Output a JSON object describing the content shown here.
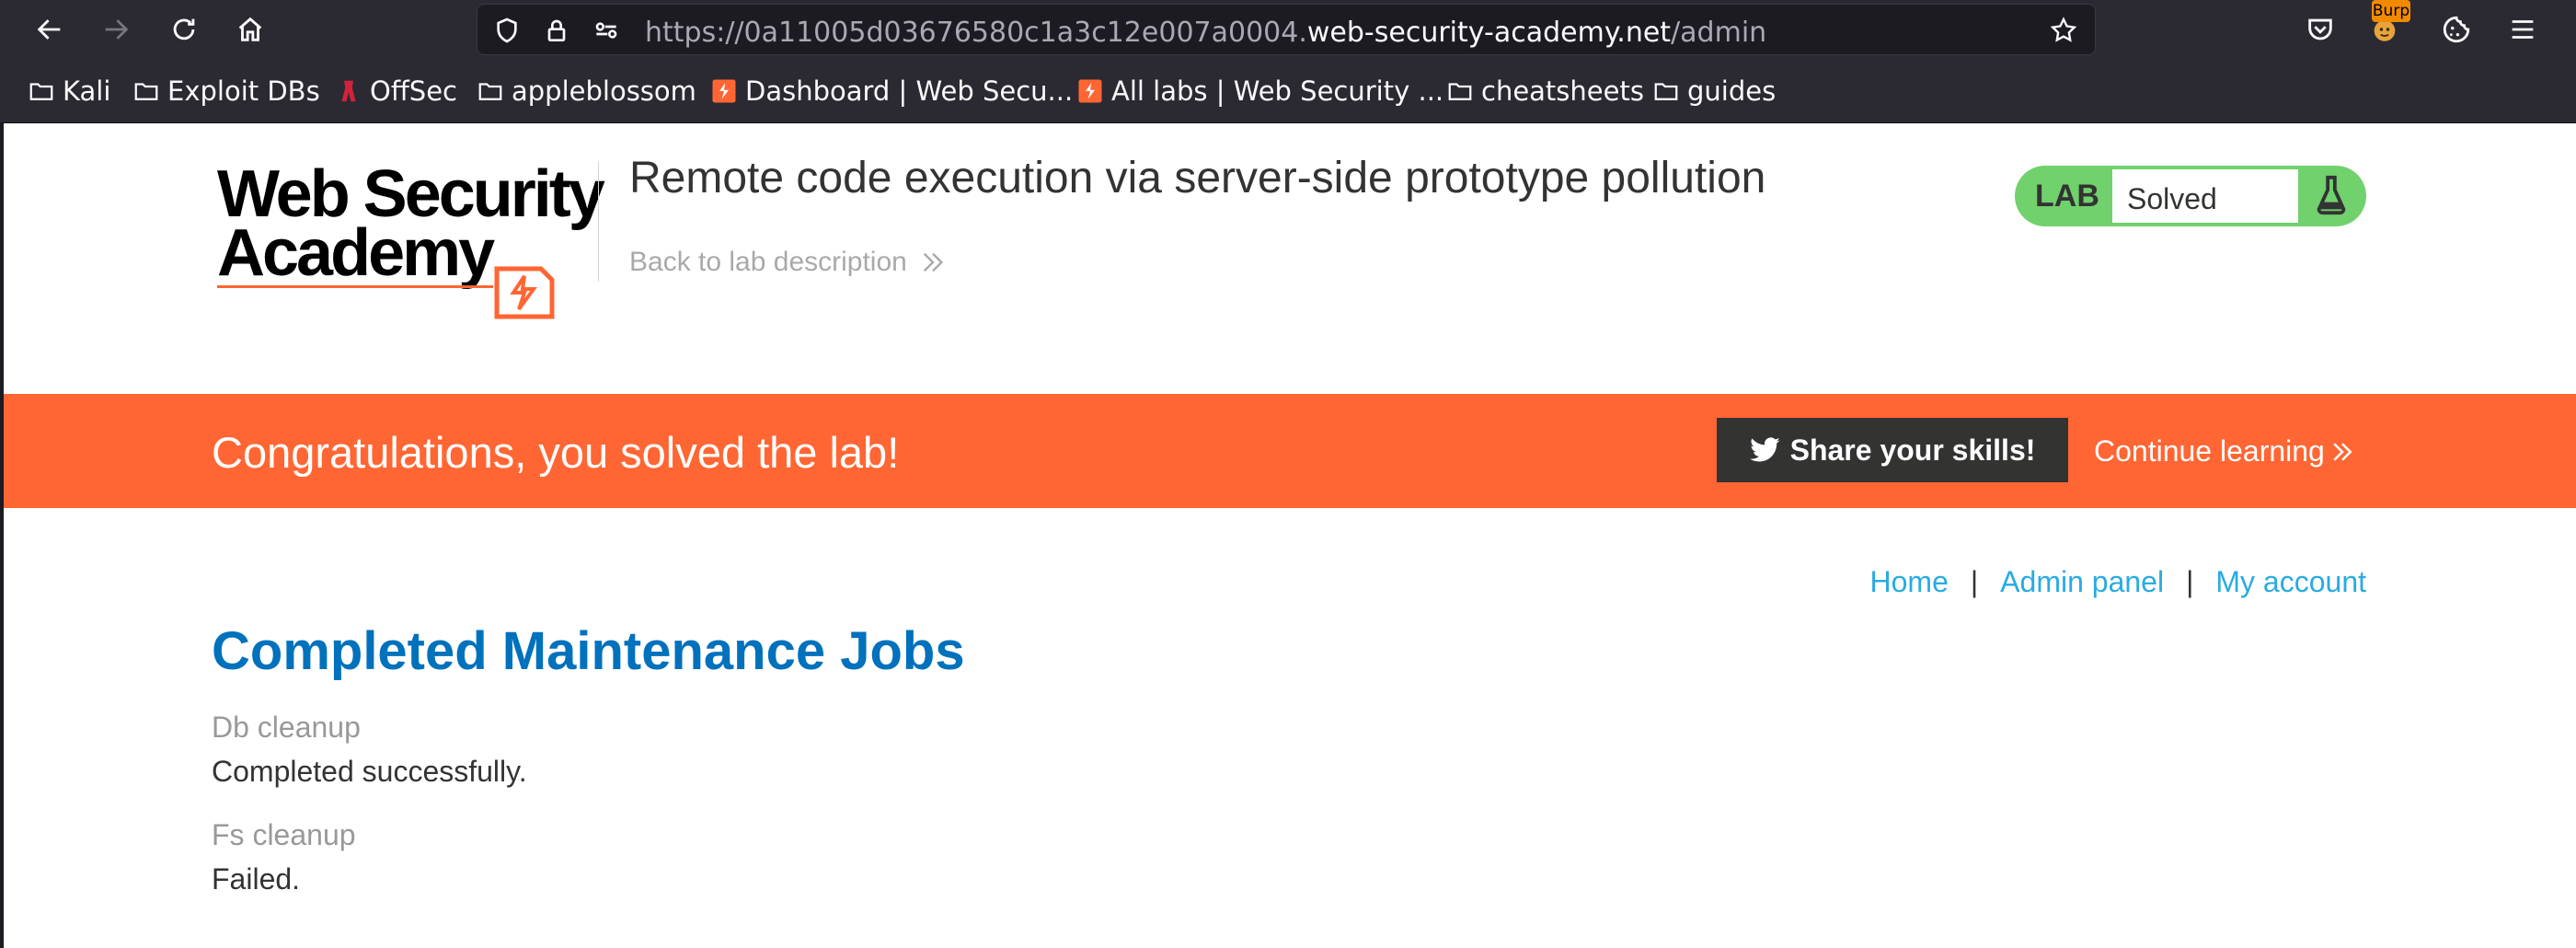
{
  "browser": {
    "url_prefix": "https://0a11005d03676580c1a3c12e007a0004.",
    "url_domain": "web-security-academy.net",
    "url_path": "/admin",
    "burp_badge": "Burp",
    "bookmarks": [
      {
        "label": "Kali",
        "icon": "folder-icon"
      },
      {
        "label": "Exploit DBs",
        "icon": "folder-icon"
      },
      {
        "label": "OffSec",
        "icon": "offsec-icon"
      },
      {
        "label": "appleblossom",
        "icon": "folder-icon"
      },
      {
        "label": "Dashboard | Web Secu...",
        "icon": "portswigger-icon"
      },
      {
        "label": "All labs | Web Security ...",
        "icon": "portswigger-icon"
      },
      {
        "label": "cheatsheets",
        "icon": "folder-icon"
      },
      {
        "label": "guides",
        "icon": "folder-icon"
      }
    ]
  },
  "header": {
    "logo_line1": "Web Security",
    "logo_line2": "Academy",
    "lab_title": "Remote code execution via server-side prototype pollution",
    "back_link": "Back to lab description",
    "lab_badge_label": "LAB",
    "lab_status": "Solved"
  },
  "banner": {
    "message": "Congratulations, you solved the lab!",
    "share_label": "Share your skills!",
    "continue_label": "Continue learning"
  },
  "nav": {
    "home": "Home",
    "admin_panel": "Admin panel",
    "my_account": "My account",
    "separator": "|"
  },
  "main": {
    "title": "Completed Maintenance Jobs",
    "jobs": [
      {
        "name": "Db cleanup",
        "status": "Completed successfully."
      },
      {
        "name": "Fs cleanup",
        "status": "Failed."
      }
    ]
  },
  "colors": {
    "accent_orange": "#ff6633",
    "lab_green": "#70d16d",
    "link_blue": "#29abe2",
    "title_blue": "#0071bc"
  }
}
